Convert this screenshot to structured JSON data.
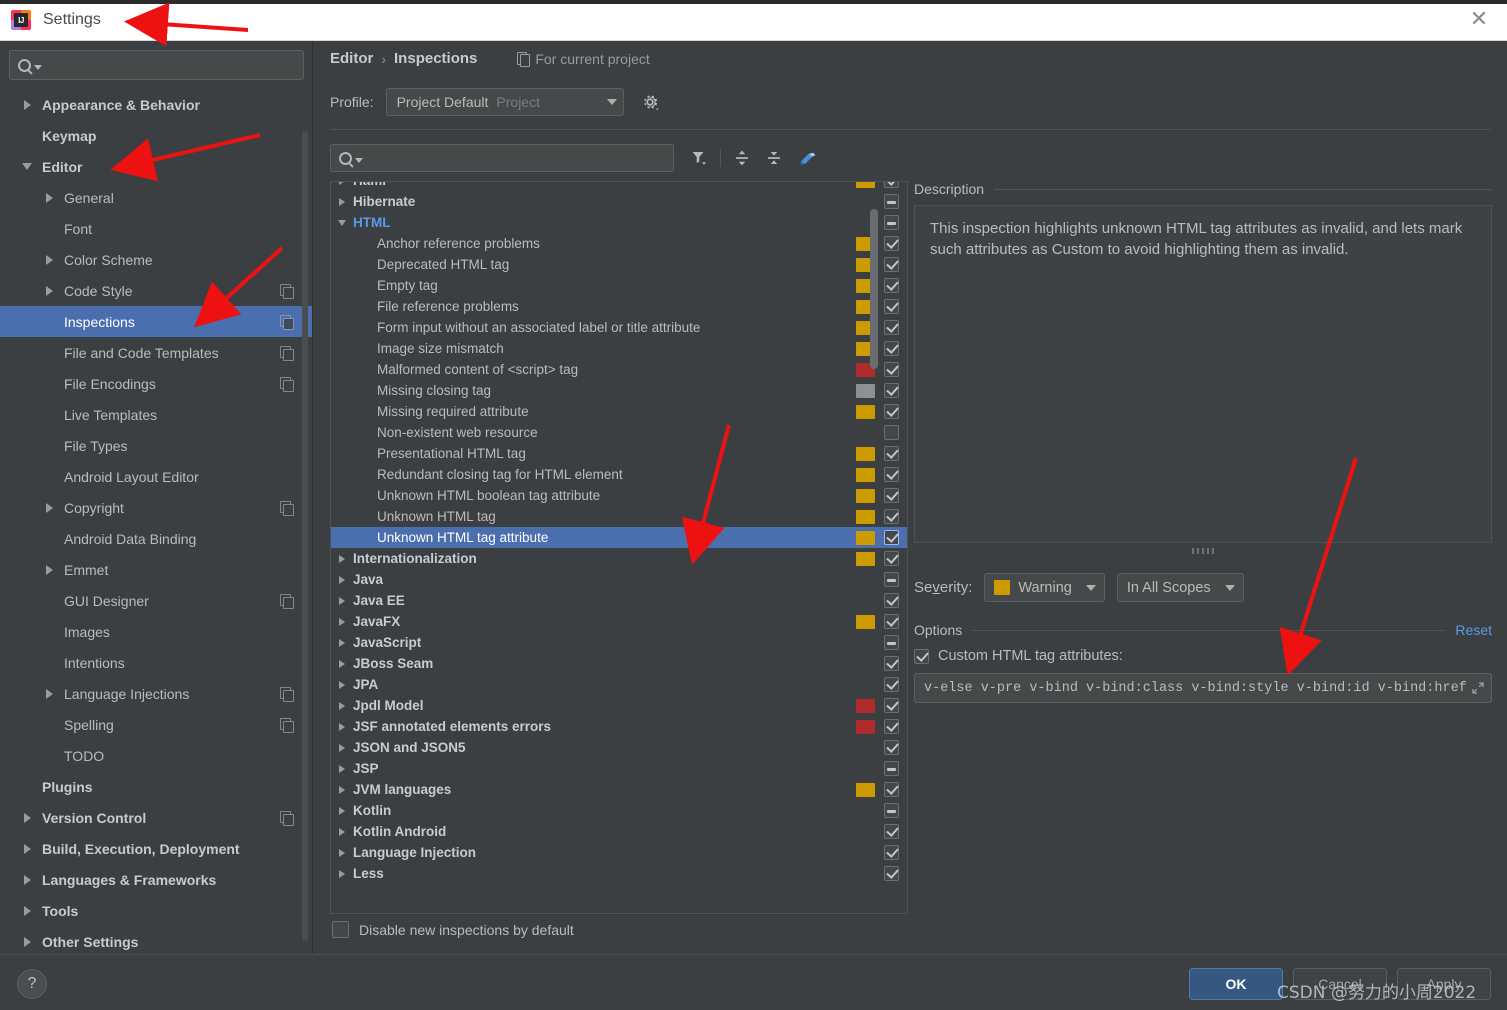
{
  "window": {
    "title": "Settings",
    "app_icon": "intellij-idea-icon",
    "close_icon": "close-icon"
  },
  "sidebar": {
    "search": {
      "placeholder": "",
      "value": "",
      "icon": "search-icon"
    },
    "items": [
      {
        "label": "Appearance & Behavior",
        "arrow": "right",
        "level": 0,
        "bold": true,
        "badge": false,
        "selected": false
      },
      {
        "label": "Keymap",
        "arrow": "none",
        "level": 0,
        "bold": true,
        "badge": false,
        "selected": false
      },
      {
        "label": "Editor",
        "arrow": "down",
        "level": 0,
        "bold": true,
        "badge": false,
        "selected": false
      },
      {
        "label": "General",
        "arrow": "right",
        "level": 1,
        "bold": false,
        "badge": false,
        "selected": false
      },
      {
        "label": "Font",
        "arrow": "none",
        "level": 1,
        "bold": false,
        "badge": false,
        "selected": false
      },
      {
        "label": "Color Scheme",
        "arrow": "right",
        "level": 1,
        "bold": false,
        "badge": false,
        "selected": false
      },
      {
        "label": "Code Style",
        "arrow": "right",
        "level": 1,
        "bold": false,
        "badge": true,
        "selected": false
      },
      {
        "label": "Inspections",
        "arrow": "none",
        "level": 1,
        "bold": false,
        "badge": true,
        "selected": true
      },
      {
        "label": "File and Code Templates",
        "arrow": "none",
        "level": 1,
        "bold": false,
        "badge": true,
        "selected": false
      },
      {
        "label": "File Encodings",
        "arrow": "none",
        "level": 1,
        "bold": false,
        "badge": true,
        "selected": false
      },
      {
        "label": "Live Templates",
        "arrow": "none",
        "level": 1,
        "bold": false,
        "badge": false,
        "selected": false
      },
      {
        "label": "File Types",
        "arrow": "none",
        "level": 1,
        "bold": false,
        "badge": false,
        "selected": false
      },
      {
        "label": "Android Layout Editor",
        "arrow": "none",
        "level": 1,
        "bold": false,
        "badge": false,
        "selected": false
      },
      {
        "label": "Copyright",
        "arrow": "right",
        "level": 1,
        "bold": false,
        "badge": true,
        "selected": false
      },
      {
        "label": "Android Data Binding",
        "arrow": "none",
        "level": 1,
        "bold": false,
        "badge": false,
        "selected": false
      },
      {
        "label": "Emmet",
        "arrow": "right",
        "level": 1,
        "bold": false,
        "badge": false,
        "selected": false
      },
      {
        "label": "GUI Designer",
        "arrow": "none",
        "level": 1,
        "bold": false,
        "badge": true,
        "selected": false
      },
      {
        "label": "Images",
        "arrow": "none",
        "level": 1,
        "bold": false,
        "badge": false,
        "selected": false
      },
      {
        "label": "Intentions",
        "arrow": "none",
        "level": 1,
        "bold": false,
        "badge": false,
        "selected": false
      },
      {
        "label": "Language Injections",
        "arrow": "right",
        "level": 1,
        "bold": false,
        "badge": true,
        "selected": false
      },
      {
        "label": "Spelling",
        "arrow": "none",
        "level": 1,
        "bold": false,
        "badge": true,
        "selected": false
      },
      {
        "label": "TODO",
        "arrow": "none",
        "level": 1,
        "bold": false,
        "badge": false,
        "selected": false
      },
      {
        "label": "Plugins",
        "arrow": "none",
        "level": 0,
        "bold": true,
        "badge": false,
        "selected": false
      },
      {
        "label": "Version Control",
        "arrow": "right",
        "level": 0,
        "bold": true,
        "badge": true,
        "selected": false
      },
      {
        "label": "Build, Execution, Deployment",
        "arrow": "right",
        "level": 0,
        "bold": true,
        "badge": false,
        "selected": false
      },
      {
        "label": "Languages & Frameworks",
        "arrow": "right",
        "level": 0,
        "bold": true,
        "badge": false,
        "selected": false
      },
      {
        "label": "Tools",
        "arrow": "right",
        "level": 0,
        "bold": true,
        "badge": false,
        "selected": false
      },
      {
        "label": "Other Settings",
        "arrow": "right",
        "level": 0,
        "bold": true,
        "badge": false,
        "selected": false
      }
    ]
  },
  "main": {
    "breadcrumb": {
      "parent": "Editor",
      "separator": "›",
      "current": "Inspections"
    },
    "scope_note": {
      "label": "For current project",
      "icon": "copy-icon"
    },
    "profile": {
      "label": "Profile:",
      "value": "Project Default",
      "suffix": "Project",
      "gear_icon": "gear-icon"
    },
    "toolbar": {
      "search": {
        "placeholder": "",
        "value": "",
        "icon": "search-icon"
      },
      "filter_icon": "filter-funnel-icon",
      "expand_all_icon": "expand-all-icon",
      "collapse_all_icon": "collapse-all-icon",
      "reset_icon": "eraser-icon"
    },
    "disable_default": {
      "label": "Disable new inspections by default",
      "checked": false
    }
  },
  "inspection_tree": [
    {
      "label": "Haml",
      "type": "group",
      "arrow": "right",
      "severity": "warning",
      "check": "checked",
      "selected": false
    },
    {
      "label": "Hibernate",
      "type": "group",
      "arrow": "right",
      "severity": "none",
      "check": "partial",
      "selected": false
    },
    {
      "label": "HTML",
      "type": "group",
      "arrow": "down",
      "severity": "none",
      "check": "partial",
      "selected": false,
      "active": true
    },
    {
      "label": "Anchor reference problems",
      "type": "child",
      "arrow": "none",
      "severity": "warning",
      "check": "checked",
      "selected": false
    },
    {
      "label": "Deprecated HTML tag",
      "type": "child",
      "arrow": "none",
      "severity": "warning",
      "check": "checked",
      "selected": false
    },
    {
      "label": "Empty tag",
      "type": "child",
      "arrow": "none",
      "severity": "warning",
      "check": "checked",
      "selected": false
    },
    {
      "label": "File reference problems",
      "type": "child",
      "arrow": "none",
      "severity": "warning",
      "check": "checked",
      "selected": false
    },
    {
      "label": "Form input without an associated label or title attribute",
      "type": "child",
      "arrow": "none",
      "severity": "warning",
      "check": "checked",
      "selected": false
    },
    {
      "label": "Image size mismatch",
      "type": "child",
      "arrow": "none",
      "severity": "warning",
      "check": "checked",
      "selected": false
    },
    {
      "label": "Malformed content of <script> tag",
      "type": "child",
      "arrow": "none",
      "severity": "error",
      "check": "checked",
      "selected": false
    },
    {
      "label": "Missing closing tag",
      "type": "child",
      "arrow": "none",
      "severity": "gray",
      "check": "checked",
      "selected": false
    },
    {
      "label": "Missing required attribute",
      "type": "child",
      "arrow": "none",
      "severity": "warning",
      "check": "checked",
      "selected": false
    },
    {
      "label": "Non-existent web resource",
      "type": "child",
      "arrow": "none",
      "severity": "none",
      "check": "unchecked",
      "selected": false
    },
    {
      "label": "Presentational HTML tag",
      "type": "child",
      "arrow": "none",
      "severity": "warning",
      "check": "checked",
      "selected": false
    },
    {
      "label": "Redundant closing tag for HTML element",
      "type": "child",
      "arrow": "none",
      "severity": "warning",
      "check": "checked",
      "selected": false
    },
    {
      "label": "Unknown HTML boolean tag attribute",
      "type": "child",
      "arrow": "none",
      "severity": "warning",
      "check": "checked",
      "selected": false
    },
    {
      "label": "Unknown HTML tag",
      "type": "child",
      "arrow": "none",
      "severity": "warning",
      "check": "checked",
      "selected": false
    },
    {
      "label": "Unknown HTML tag attribute",
      "type": "child",
      "arrow": "none",
      "severity": "warning",
      "check": "checked",
      "selected": true
    },
    {
      "label": "Internationalization",
      "type": "group",
      "arrow": "right",
      "severity": "warning",
      "check": "checked",
      "selected": false
    },
    {
      "label": "Java",
      "type": "group",
      "arrow": "right",
      "severity": "none",
      "check": "partial",
      "selected": false
    },
    {
      "label": "Java EE",
      "type": "group",
      "arrow": "right",
      "severity": "none",
      "check": "checked",
      "selected": false
    },
    {
      "label": "JavaFX",
      "type": "group",
      "arrow": "right",
      "severity": "warning",
      "check": "checked",
      "selected": false
    },
    {
      "label": "JavaScript",
      "type": "group",
      "arrow": "right",
      "severity": "none",
      "check": "partial",
      "selected": false
    },
    {
      "label": "JBoss Seam",
      "type": "group",
      "arrow": "right",
      "severity": "none",
      "check": "checked",
      "selected": false
    },
    {
      "label": "JPA",
      "type": "group",
      "arrow": "right",
      "severity": "none",
      "check": "checked",
      "selected": false
    },
    {
      "label": "Jpdl Model",
      "type": "group",
      "arrow": "right",
      "severity": "error",
      "check": "checked",
      "selected": false
    },
    {
      "label": "JSF annotated elements errors",
      "type": "group",
      "arrow": "right",
      "severity": "error",
      "check": "checked",
      "selected": false
    },
    {
      "label": "JSON and JSON5",
      "type": "group",
      "arrow": "right",
      "severity": "none",
      "check": "checked",
      "selected": false
    },
    {
      "label": "JSP",
      "type": "group",
      "arrow": "right",
      "severity": "none",
      "check": "partial",
      "selected": false
    },
    {
      "label": "JVM languages",
      "type": "group",
      "arrow": "right",
      "severity": "warning",
      "check": "checked",
      "selected": false
    },
    {
      "label": "Kotlin",
      "type": "group",
      "arrow": "right",
      "severity": "none",
      "check": "partial",
      "selected": false
    },
    {
      "label": "Kotlin Android",
      "type": "group",
      "arrow": "right",
      "severity": "none",
      "check": "checked",
      "selected": false
    },
    {
      "label": "Language Injection",
      "type": "group",
      "arrow": "right",
      "severity": "none",
      "check": "checked",
      "selected": false
    },
    {
      "label": "Less",
      "type": "group",
      "arrow": "right",
      "severity": "none",
      "check": "checked",
      "selected": false
    }
  ],
  "detail": {
    "description_title": "Description",
    "description_text": "This inspection highlights unknown HTML tag attributes as invalid, and lets mark such attributes as Custom to avoid highlighting them as invalid.",
    "severity": {
      "label": "Severity:",
      "label_prefix": "Se",
      "label_underlined": "v",
      "label_suffix": "erity:",
      "value": "Warning",
      "swatch_color": "#cb9b00",
      "scope_value": "In All Scopes"
    },
    "options": {
      "title": "Options",
      "reset_label": "Reset",
      "checkbox_label": "Custom HTML tag attributes:",
      "checkbox_checked": true,
      "attributes_value": "v-else v-pre v-bind v-bind:class v-bind:style v-bind:id v-bind:href",
      "expand_icon": "expand-editor-icon"
    }
  },
  "footer": {
    "help_label": "?",
    "ok_label": "OK",
    "cancel_label": "Cancel",
    "apply_label": "Apply"
  },
  "watermark": {
    "text": "CSDN @努力的小周2022"
  },
  "colors": {
    "accent_blue": "#4b6eaf",
    "link_blue": "#5a9ae6",
    "warning": "#cb9b00",
    "error": "#b02c2c",
    "gray_sev": "#8e9192",
    "panel_bg": "#3c3f41",
    "annotation_red": "#ee1111"
  }
}
